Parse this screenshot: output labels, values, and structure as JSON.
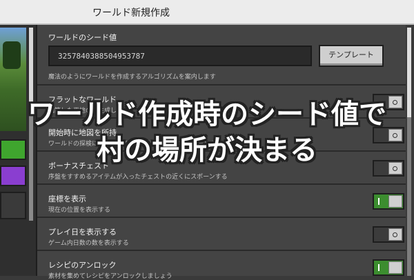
{
  "window": {
    "title": "ワールド新規作成"
  },
  "seed": {
    "label": "ワールドのシード値",
    "value": "3257840388504953787",
    "template_button": "テンプレート",
    "description": "魔法のようにワールドを作成するアルゴリズムを案内します"
  },
  "settings": [
    {
      "label": "フラットなワールド",
      "description": "構築した平地のみ生成します",
      "enabled": false
    },
    {
      "label": "開始時に地図を所持",
      "description": "ワールドの探検に使う空白の地図を持った状態でスポーンする",
      "enabled": false
    },
    {
      "label": "ボーナスチェスト",
      "description": "序盤をすすめるアイテムが入ったチェストの近くにスポーンする",
      "enabled": false
    },
    {
      "label": "座標を表示",
      "description": "現在の位置を表示する",
      "enabled": true
    },
    {
      "label": "プレイ日を表示する",
      "description": "ゲーム内日数の数を表示する",
      "enabled": false
    },
    {
      "label": "レシピのアンロック",
      "description": "素材を集めてレシピをアンロックしましょう",
      "enabled": true
    }
  ],
  "overlay": {
    "line1": "ワールド作成時のシード値で",
    "line2": "村の場所が決まる"
  },
  "colors": {
    "toggle_on": "#3c8d2f",
    "overlay_text": "#ffffff"
  }
}
